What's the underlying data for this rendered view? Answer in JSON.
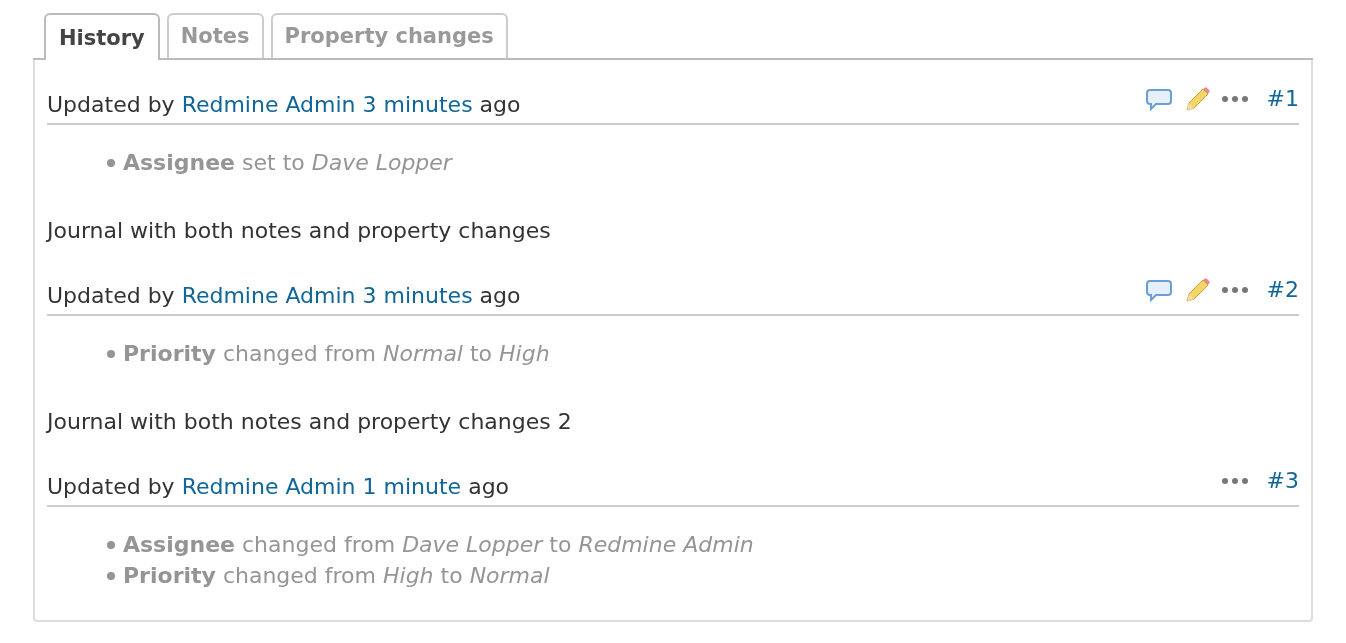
{
  "tabs": [
    {
      "label": "History",
      "selected": true
    },
    {
      "label": "Notes",
      "selected": false
    },
    {
      "label": "Property changes",
      "selected": false
    }
  ],
  "journals": [
    {
      "prefix": "Updated by",
      "author": "Redmine Admin",
      "time": "3 minutes",
      "suffix": "ago",
      "actions": [
        {
          "kind": "quote"
        },
        {
          "kind": "edit"
        },
        {
          "kind": "more"
        }
      ],
      "number": "#1",
      "details": [
        "**Assignee** set to *Dave Lopper*"
      ],
      "notes": "Journal with both notes and property changes"
    },
    {
      "prefix": "Updated by",
      "author": "Redmine Admin",
      "time": "3 minutes",
      "suffix": "ago",
      "actions": [
        {
          "kind": "quote"
        },
        {
          "kind": "edit"
        },
        {
          "kind": "more"
        }
      ],
      "number": "#2",
      "details": [
        "**Priority** changed from *Normal* to *High*"
      ],
      "notes": "Journal with both notes and property changes 2"
    },
    {
      "prefix": "Updated by",
      "author": "Redmine Admin",
      "time": "1 minute",
      "suffix": "ago",
      "actions": [
        {
          "kind": "more"
        }
      ],
      "number": "#3",
      "details": [
        "**Assignee** changed from *Dave Lopper* to *Redmine Admin*",
        "**Priority** changed from *High* to *Normal*"
      ]
    }
  ]
}
